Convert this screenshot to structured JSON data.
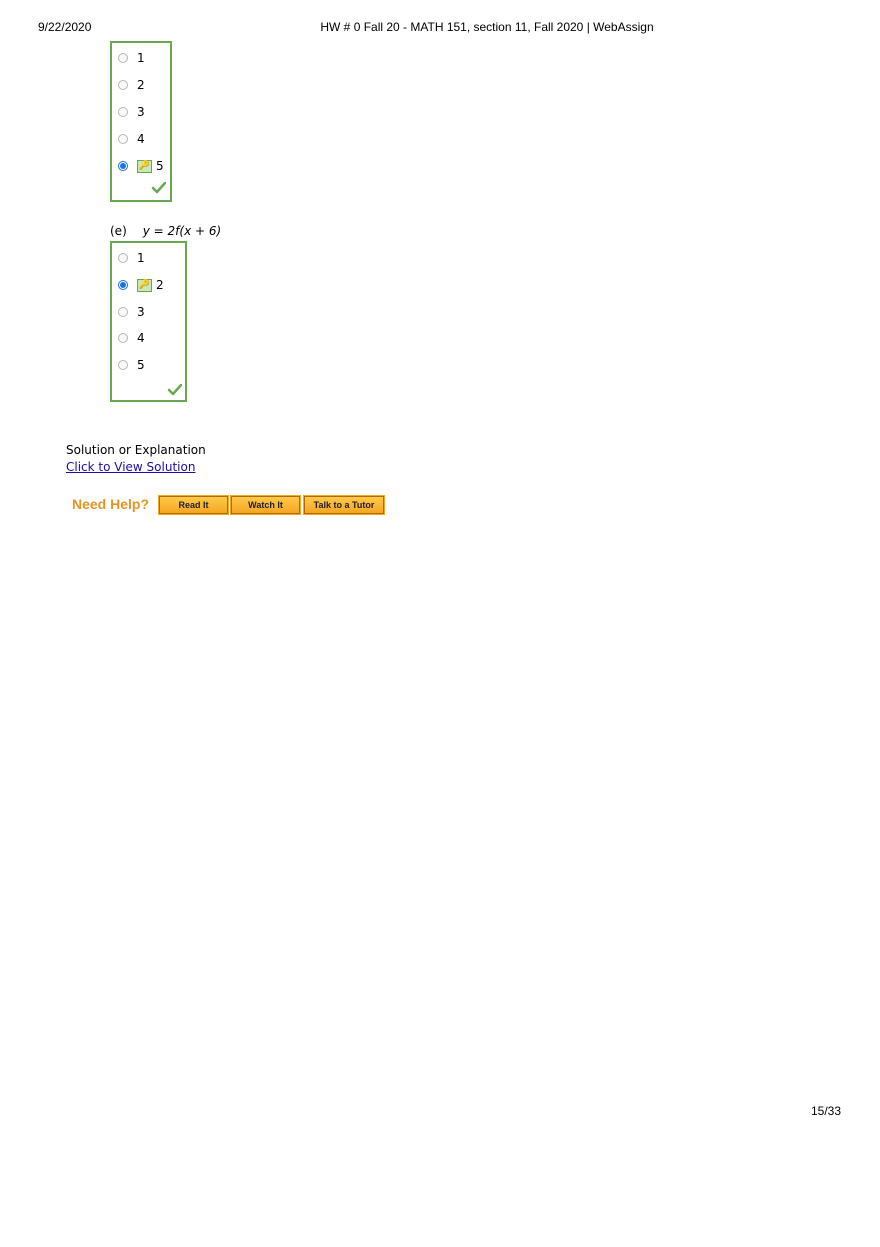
{
  "print_header": {
    "date": "9/22/2020",
    "title": "HW # 0 Fall 20 - MATH 151, section 11, Fall 2020 | WebAssign"
  },
  "question_d": {
    "options": [
      "1",
      "2",
      "3",
      "4",
      "5"
    ],
    "selected": "5",
    "status": "correct"
  },
  "question_e": {
    "label": "(e)",
    "equation": "y = 2f(x + 6)",
    "options": [
      "1",
      "2",
      "3",
      "4",
      "5"
    ],
    "selected": "2",
    "status": "correct"
  },
  "solution": {
    "heading": "Solution or Explanation",
    "link": "Click to View Solution"
  },
  "help": {
    "label": "Need Help?",
    "buttons": [
      "Read It",
      "Watch It",
      "Talk to a Tutor"
    ]
  },
  "page_number": "15/33",
  "colors": {
    "box_border": "#6aa84f",
    "radio_selected": "#1a73e8",
    "link": "#1a0dab",
    "help_orange": "#e69522"
  },
  "icons": {
    "key": "key-icon",
    "check": "check-icon"
  }
}
